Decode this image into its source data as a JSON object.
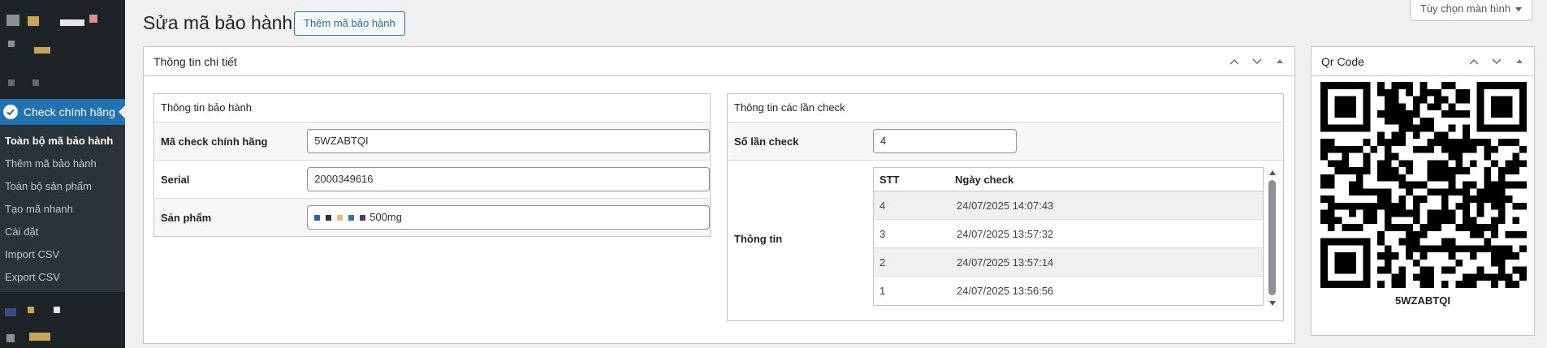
{
  "sidebar": {
    "active_menu": "Check chính hãng",
    "submenu": [
      "Toàn bộ mã bảo hành",
      "Thêm mã bảo hành",
      "Toàn bộ sản phẩm",
      "Tạo mã nhanh",
      "Cài đặt",
      "Import CSV",
      "Export CSV"
    ]
  },
  "header": {
    "title": "Sửa mã bảo hành",
    "add_button": "Thêm mã bảo hành",
    "screen_options": "Tùy chọn màn hình"
  },
  "main_box": {
    "title": "Thông tin chi tiết",
    "warranty": {
      "title": "Thông tin bảo hành",
      "code_label": "Mã check chính hãng",
      "code_value": "5WZABTQI",
      "serial_label": "Serial",
      "serial_value": "2000349616",
      "product_label": "Sản phẩm",
      "product_value": "500mg"
    },
    "checks": {
      "title": "Thông tin các lần check",
      "count_label": "Số lần check",
      "count_value": "4",
      "info_label": "Thông tin",
      "columns": [
        "STT",
        "Ngày check"
      ],
      "rows": [
        {
          "stt": "4",
          "date": "24/07/2025 14:07:43"
        },
        {
          "stt": "3",
          "date": "24/07/2025 13:57:32"
        },
        {
          "stt": "2",
          "date": "24/07/2025 13:57:14"
        },
        {
          "stt": "1",
          "date": "24/07/2025 13:56:56"
        }
      ]
    }
  },
  "qr_box": {
    "title": "Qr Code",
    "code": "5WZABTQI"
  },
  "colors": {
    "accent": "#2271b1",
    "sidebar_bg": "#1d2327",
    "submenu_bg": "#2c3338",
    "page_bg": "#f0f0f1"
  },
  "icons": {
    "menu_active": "check-circle-icon",
    "panel_controls": [
      "chevron-up-icon",
      "chevron-down-icon",
      "caret-up-icon"
    ]
  }
}
